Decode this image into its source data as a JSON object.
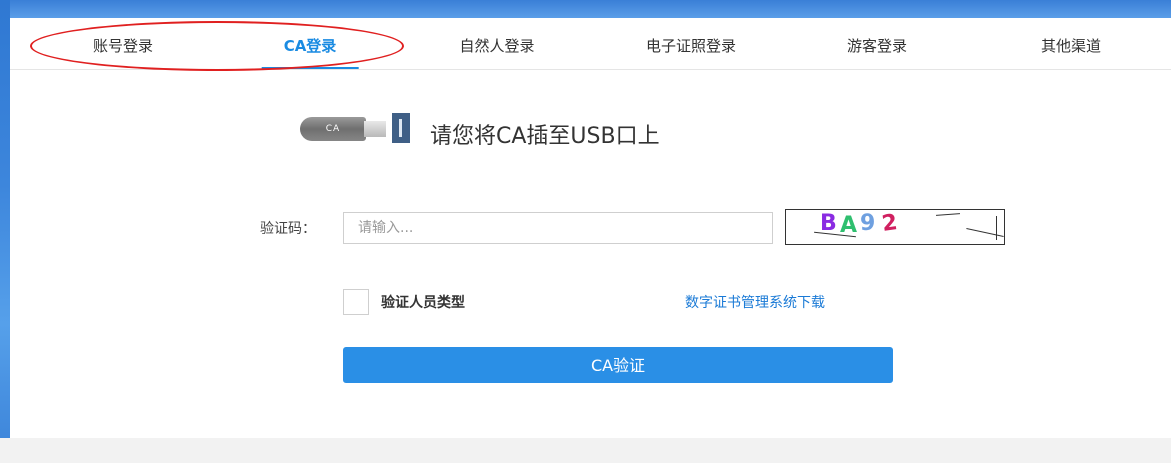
{
  "tabs": [
    {
      "label": "账号登录"
    },
    {
      "label": "CA登录",
      "active": true
    },
    {
      "label": "自然人登录"
    },
    {
      "label": "电子证照登录"
    },
    {
      "label": "游客登录"
    },
    {
      "label": "其他渠道"
    }
  ],
  "usb_icon": {
    "text": "CA",
    "icon": "usb-key-icon"
  },
  "instruction": "请您将CA插至USB口上",
  "captcha": {
    "label": "验证码：",
    "placeholder": "请输入...",
    "value": "",
    "image_text": {
      "c1": "B",
      "c2": "A",
      "c3": "9",
      "c4": "2"
    }
  },
  "verify_person_type": {
    "label": "验证人员类型",
    "checked": false
  },
  "download_link": "数字证书管理系统下载",
  "verify_button": "CA验证",
  "colors": {
    "accent": "#1a8be2",
    "button": "#2a8fe6",
    "annotation_ellipse": "#e02020",
    "captcha_colors": [
      "#8a2be2",
      "#2fbf6f",
      "#6fa0e0",
      "#d02060"
    ]
  }
}
